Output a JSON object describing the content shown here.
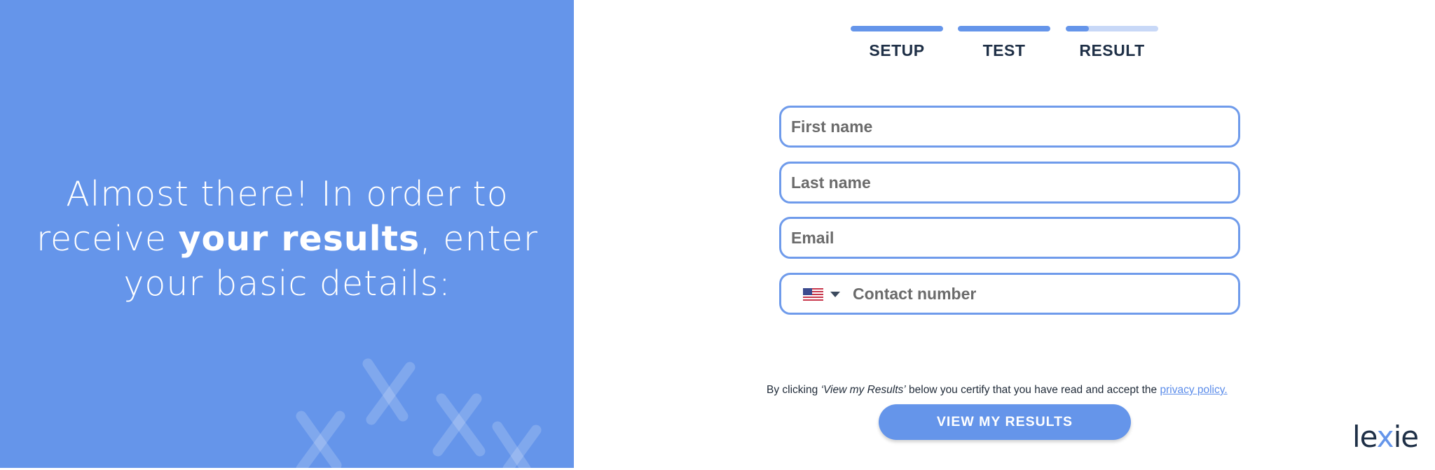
{
  "hero": {
    "line1": "Almost there! In order to",
    "line2_pre": "receive ",
    "line2_bold": "your results",
    "line2_post": ", enter",
    "line3": "your basic details:"
  },
  "steps": [
    {
      "label": "SETUP",
      "progress": 1.0
    },
    {
      "label": "TEST",
      "progress": 1.0
    },
    {
      "label": "RESULT",
      "progress": 0.25
    }
  ],
  "form": {
    "first_name_placeholder": "First name",
    "last_name_placeholder": "Last name",
    "email_placeholder": "Email",
    "contact_placeholder": "Contact number",
    "country_flag": "us-flag-icon"
  },
  "legal": {
    "prefix": "By clicking ",
    "cta_ref": "‘View my Results’",
    "middle": " below you certify that you have read and accept the ",
    "link": "privacy policy."
  },
  "cta_label": "VIEW MY RESULTS",
  "logo": {
    "pre": "le",
    "x": "x",
    "post": "ie"
  },
  "colors": {
    "accent": "#6595EA",
    "accent_light": "#C8D8F7",
    "text_dark": "#1F3047"
  }
}
